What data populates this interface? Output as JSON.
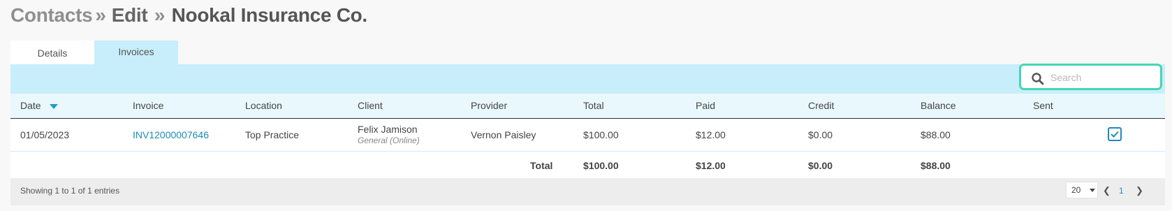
{
  "header": {
    "crumb": "Contacts",
    "sep": "»",
    "edit": "Edit",
    "sep2": "»",
    "name": "Nookal Insurance Co."
  },
  "tabs": [
    {
      "label": "Details"
    },
    {
      "label": "Invoices"
    }
  ],
  "search": {
    "placeholder": "Search",
    "value": ""
  },
  "table": {
    "columns": [
      "Date",
      "Invoice",
      "Location",
      "Client",
      "Provider",
      "Total",
      "Paid",
      "Credit",
      "Balance",
      "Sent"
    ],
    "sorted_column": "Date",
    "rows": [
      {
        "date": "01/05/2023",
        "invoice": "INV12000007646",
        "location": "Top Practice",
        "client": "Felix Jamison",
        "client_sub": "General (Online)",
        "provider": "Vernon Paisley",
        "total": "$100.00",
        "paid": "$12.00",
        "credit": "$0.00",
        "balance": "$88.00",
        "sent": true
      }
    ],
    "totals": {
      "label": "Total",
      "total": "$100.00",
      "paid": "$12.00",
      "credit": "$0.00",
      "balance": "$88.00"
    }
  },
  "footer": {
    "info": "Showing 1 to 1 of 1 entries",
    "page_size": "20",
    "prev": "❮",
    "page": "1",
    "next": "❯"
  },
  "colors": {
    "accent": "#1e8bb8",
    "tab_active": "#c7eefa",
    "search_border": "#46d6b0"
  },
  "icons": {
    "search": "search-icon",
    "sort": "sort-desc-icon",
    "checkbox": "checkbox-checked-icon"
  }
}
